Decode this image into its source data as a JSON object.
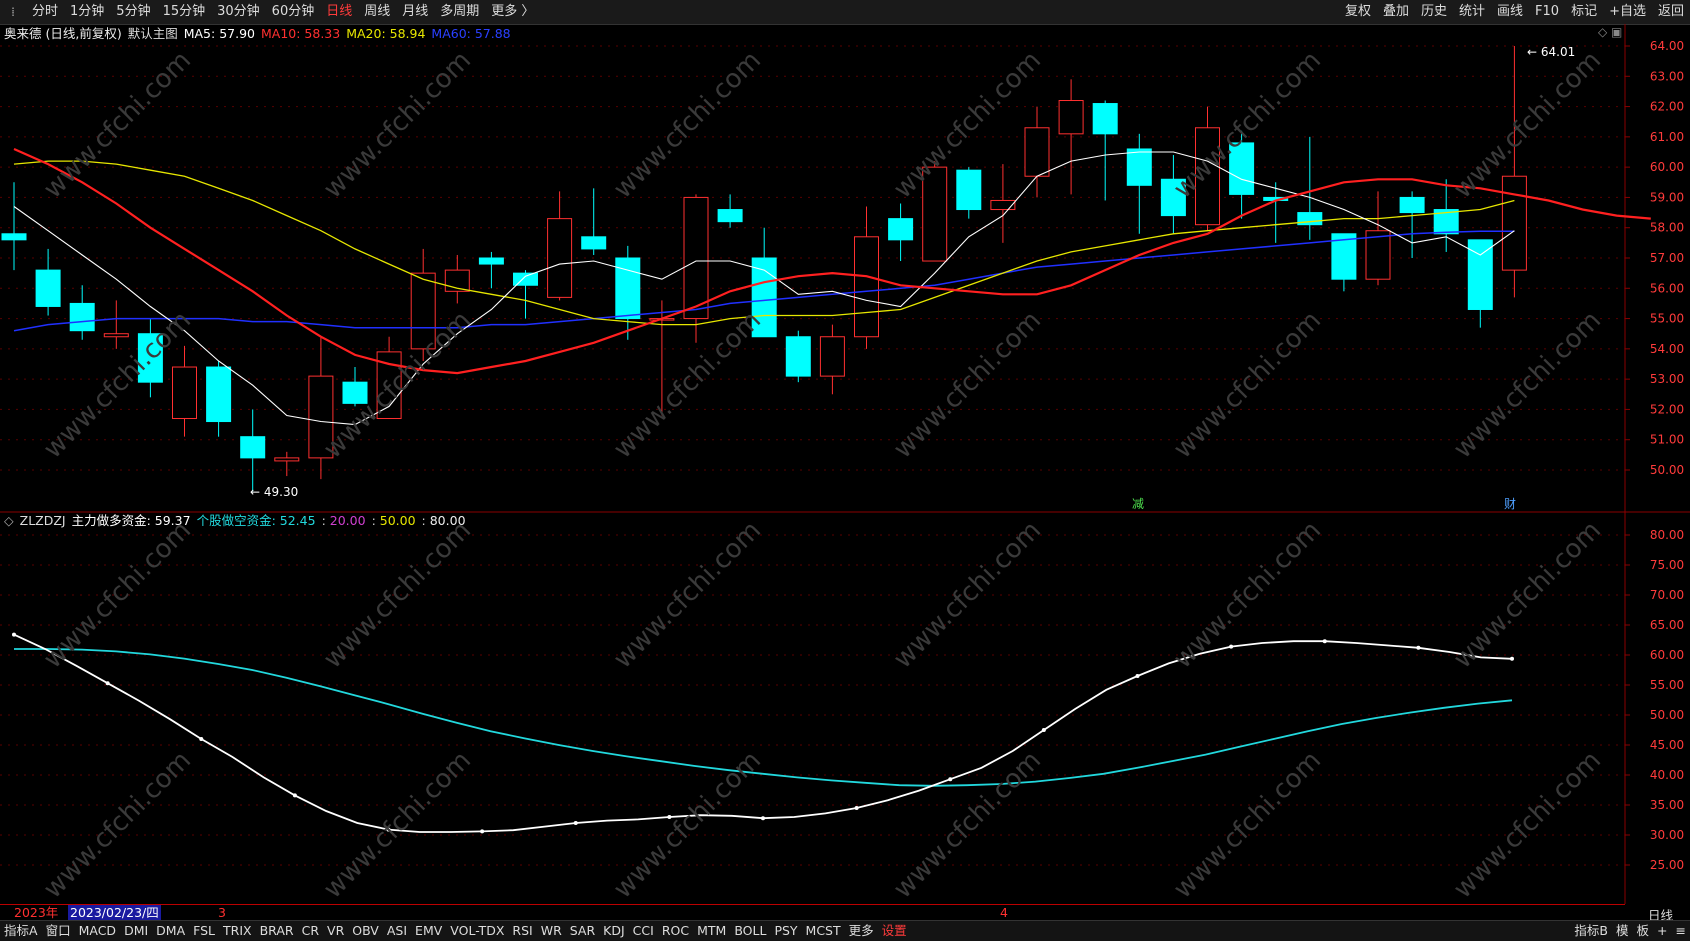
{
  "topbar": {
    "menu_glyph": "⁞",
    "periods": [
      "分时",
      "1分钟",
      "5分钟",
      "15分钟",
      "30分钟",
      "60分钟",
      "日线",
      "周线",
      "月线",
      "多周期",
      "更多 〉"
    ],
    "active_period": "日线",
    "right_buttons": [
      "复权",
      "叠加",
      "历史",
      "统计",
      "画线",
      "F10",
      "标记",
      "+自选",
      "返回"
    ]
  },
  "main_panel": {
    "title": "奥来德 (日线,前复权)",
    "indicator_name": "默认主图",
    "ma5": "MA5: 57.90",
    "ma10": "MA10: 58.33",
    "ma20": "MA20: 58.94",
    "ma60": "MA60: 57.88",
    "high_label": "64.01",
    "low_label": "49.30",
    "markers": [
      {
        "text": "减"
      },
      {
        "text": "财"
      }
    ],
    "colors": {
      "ma5": "#ffffff",
      "ma10": "#ff2020",
      "ma20": "#e6e600",
      "ma60": "#2030ff",
      "up": "#ff3030",
      "down": "#00ffff"
    }
  },
  "chart_data": [
    {
      "type": "candlestick",
      "title": "奥来德 (日线,前复权)",
      "ylim": [
        49.3,
        64.5
      ],
      "y_ticks": [
        "64.00",
        "63.00",
        "62.00",
        "61.00",
        "60.00",
        "59.00",
        "58.00",
        "57.00",
        "56.00",
        "55.00",
        "54.00",
        "53.00",
        "52.00",
        "51.00",
        "50.00"
      ],
      "candles": [
        {
          "o": 57.8,
          "h": 59.5,
          "l": 56.6,
          "c": 57.6
        },
        {
          "o": 56.6,
          "h": 57.3,
          "l": 55.1,
          "c": 55.4
        },
        {
          "o": 55.5,
          "h": 56.1,
          "l": 54.3,
          "c": 54.6
        },
        {
          "o": 54.4,
          "h": 55.6,
          "l": 54.0,
          "c": 54.5
        },
        {
          "o": 54.5,
          "h": 55.0,
          "l": 52.4,
          "c": 52.9
        },
        {
          "o": 51.7,
          "h": 54.1,
          "l": 51.1,
          "c": 53.4
        },
        {
          "o": 53.4,
          "h": 53.6,
          "l": 51.1,
          "c": 51.6
        },
        {
          "o": 51.1,
          "h": 52.0,
          "l": 49.3,
          "c": 50.4
        },
        {
          "o": 50.3,
          "h": 50.6,
          "l": 49.8,
          "c": 50.4
        },
        {
          "o": 50.4,
          "h": 54.4,
          "l": 49.7,
          "c": 53.1
        },
        {
          "o": 52.9,
          "h": 53.4,
          "l": 52.1,
          "c": 52.2
        },
        {
          "o": 51.7,
          "h": 54.4,
          "l": 51.7,
          "c": 53.9
        },
        {
          "o": 54.0,
          "h": 57.3,
          "l": 53.6,
          "c": 56.5
        },
        {
          "o": 55.9,
          "h": 57.1,
          "l": 55.5,
          "c": 56.6
        },
        {
          "o": 57.0,
          "h": 57.2,
          "l": 56.0,
          "c": 56.8
        },
        {
          "o": 56.5,
          "h": 56.6,
          "l": 55.0,
          "c": 56.1
        },
        {
          "o": 55.7,
          "h": 59.2,
          "l": 55.6,
          "c": 58.3
        },
        {
          "o": 57.7,
          "h": 59.3,
          "l": 57.1,
          "c": 57.3
        },
        {
          "o": 57.0,
          "h": 57.4,
          "l": 54.3,
          "c": 55.0
        },
        {
          "o": 55.0,
          "h": 55.6,
          "l": 51.8,
          "c": 55.0
        },
        {
          "o": 55.0,
          "h": 59.1,
          "l": 54.2,
          "c": 59.0
        },
        {
          "o": 58.6,
          "h": 59.1,
          "l": 58.0,
          "c": 58.2
        },
        {
          "o": 57.0,
          "h": 58.0,
          "l": 55.5,
          "c": 54.4
        },
        {
          "o": 54.4,
          "h": 54.6,
          "l": 52.9,
          "c": 53.1
        },
        {
          "o": 53.1,
          "h": 54.8,
          "l": 52.5,
          "c": 54.4
        },
        {
          "o": 54.4,
          "h": 58.7,
          "l": 54.0,
          "c": 57.7
        },
        {
          "o": 58.3,
          "h": 58.8,
          "l": 56.9,
          "c": 57.6
        },
        {
          "o": 56.9,
          "h": 60.2,
          "l": 56.9,
          "c": 60.0
        },
        {
          "o": 59.9,
          "h": 60.0,
          "l": 58.3,
          "c": 58.6
        },
        {
          "o": 58.6,
          "h": 60.1,
          "l": 57.5,
          "c": 58.9
        },
        {
          "o": 59.7,
          "h": 62.0,
          "l": 59.0,
          "c": 61.3
        },
        {
          "o": 61.1,
          "h": 62.9,
          "l": 59.1,
          "c": 62.2
        },
        {
          "o": 62.1,
          "h": 62.2,
          "l": 58.9,
          "c": 61.1
        },
        {
          "o": 60.6,
          "h": 61.1,
          "l": 57.8,
          "c": 59.4
        },
        {
          "o": 59.6,
          "h": 60.4,
          "l": 57.8,
          "c": 58.4
        },
        {
          "o": 58.1,
          "h": 62.0,
          "l": 57.9,
          "c": 61.3
        },
        {
          "o": 60.8,
          "h": 61.2,
          "l": 58.3,
          "c": 59.1
        },
        {
          "o": 59.0,
          "h": 59.5,
          "l": 57.5,
          "c": 58.9
        },
        {
          "o": 58.5,
          "h": 61.0,
          "l": 57.6,
          "c": 58.1
        },
        {
          "o": 57.8,
          "h": 57.8,
          "l": 55.9,
          "c": 56.3
        },
        {
          "o": 56.3,
          "h": 59.2,
          "l": 56.1,
          "c": 57.9
        },
        {
          "o": 59.0,
          "h": 59.2,
          "l": 57.0,
          "c": 58.5
        },
        {
          "o": 58.6,
          "h": 59.6,
          "l": 57.2,
          "c": 57.8
        },
        {
          "o": 57.6,
          "h": 57.6,
          "l": 54.7,
          "c": 55.3
        },
        {
          "o": 56.6,
          "h": 64.0,
          "l": 55.7,
          "c": 59.7
        }
      ],
      "ma5": [
        58.7,
        57.9,
        57.1,
        56.3,
        55.4,
        54.6,
        53.6,
        52.8,
        51.8,
        51.6,
        51.5,
        52.1,
        53.5,
        54.5,
        55.3,
        56.4,
        56.8,
        56.9,
        56.6,
        56.3,
        56.9,
        56.9,
        56.6,
        55.8,
        55.9,
        55.6,
        55.4,
        56.5,
        57.7,
        58.4,
        59.7,
        60.2,
        60.4,
        60.5,
        60.5,
        60.2,
        59.6,
        59.3,
        59.0,
        58.6,
        58.1,
        57.5,
        57.7,
        57.1,
        57.9
      ],
      "ma10": [
        60.6,
        60.1,
        59.5,
        58.8,
        58.0,
        57.3,
        56.6,
        55.9,
        55.1,
        54.4,
        53.8,
        53.5,
        53.3,
        53.2,
        53.4,
        53.6,
        53.9,
        54.2,
        54.6,
        55.0,
        55.4,
        55.9,
        56.2,
        56.4,
        56.5,
        56.4,
        56.1,
        56.0,
        55.9,
        55.8,
        55.8,
        56.1,
        56.6,
        57.1,
        57.5,
        57.8,
        58.4,
        58.9,
        59.2,
        59.5,
        59.6,
        59.6,
        59.4,
        59.3,
        59.1,
        58.9,
        58.6,
        58.4,
        58.3
      ],
      "ma20": [
        60.1,
        60.2,
        60.2,
        60.1,
        59.9,
        59.7,
        59.3,
        58.9,
        58.4,
        57.9,
        57.3,
        56.8,
        56.3,
        56.0,
        55.8,
        55.6,
        55.3,
        55.0,
        54.9,
        54.8,
        54.8,
        55.0,
        55.1,
        55.1,
        55.1,
        55.2,
        55.3,
        55.7,
        56.1,
        56.5,
        56.9,
        57.2,
        57.4,
        57.6,
        57.8,
        57.9,
        58.0,
        58.1,
        58.2,
        58.3,
        58.3,
        58.4,
        58.5,
        58.6,
        58.9
      ],
      "ma60": [
        54.6,
        54.8,
        54.9,
        55.0,
        55.0,
        55.0,
        55.0,
        54.9,
        54.9,
        54.8,
        54.7,
        54.7,
        54.7,
        54.7,
        54.8,
        54.8,
        54.9,
        55.0,
        55.1,
        55.2,
        55.3,
        55.5,
        55.6,
        55.7,
        55.8,
        55.9,
        56.0,
        56.1,
        56.3,
        56.5,
        56.7,
        56.8,
        56.9,
        57.0,
        57.1,
        57.2,
        57.3,
        57.4,
        57.5,
        57.6,
        57.7,
        57.8,
        57.85,
        57.88,
        57.88
      ]
    },
    {
      "type": "line",
      "title": "ZLZDZJ",
      "ylim": [
        20,
        80
      ],
      "y_ticks": [
        "80.00",
        "75.00",
        "70.00",
        "65.00",
        "60.00",
        "55.00",
        "50.00",
        "45.00",
        "40.00",
        "35.00",
        "30.00",
        "25.00"
      ],
      "series": [
        {
          "name": "主力做多资金",
          "color": "#ffffff",
          "values": [
            63.4,
            61.0,
            58.2,
            55.3,
            52.4,
            49.3,
            46.0,
            43.0,
            39.6,
            36.6,
            34.0,
            32.0,
            30.9,
            30.5,
            30.5,
            30.6,
            30.8,
            31.4,
            32.0,
            32.4,
            32.6,
            33.0,
            33.3,
            33.2,
            32.8,
            33.0,
            33.6,
            34.5,
            35.8,
            37.4,
            39.3,
            41.2,
            44.0,
            47.5,
            51.0,
            54.2,
            56.5,
            58.6,
            60.2,
            61.4,
            62.0,
            62.3,
            62.3,
            62.0,
            61.6,
            61.2,
            60.5,
            59.6,
            59.37
          ]
        },
        {
          "name": "个股做空资金",
          "color": "#22d8dd",
          "values": [
            61.0,
            61.0,
            60.9,
            60.6,
            60.1,
            59.4,
            58.5,
            57.5,
            56.2,
            54.8,
            53.3,
            51.8,
            50.2,
            48.7,
            47.3,
            46.1,
            45.0,
            44.0,
            43.1,
            42.3,
            41.5,
            40.8,
            40.2,
            39.6,
            39.1,
            38.7,
            38.3,
            38.2,
            38.3,
            38.5,
            38.9,
            39.5,
            40.2,
            41.2,
            42.3,
            43.4,
            44.7,
            46.0,
            47.3,
            48.5,
            49.5,
            50.4,
            51.2,
            51.9,
            52.45
          ]
        }
      ],
      "legend_values": {
        "long": "主力做多资金: 59.37",
        "short_label": "个股做空资金:",
        "short_value": "52.45",
        "lvl20": "20.00",
        "lvl50": "50.00",
        "lvl80": "80.00"
      }
    }
  ],
  "datebar": {
    "year": "2023年",
    "date": "2023/02/23/四",
    "month3": "3",
    "month4": "4"
  },
  "right_label_bottom": "日线",
  "bottombar": {
    "items": [
      "指标A",
      "窗口",
      "MACD",
      "DMI",
      "DMA",
      "FSL",
      "TRIX",
      "BRAR",
      "CR",
      "VR",
      "OBV",
      "ASI",
      "EMV",
      "VOL-TDX",
      "RSI",
      "WR",
      "SAR",
      "KDJ",
      "CCI",
      "ROC",
      "MTM",
      "BOLL",
      "PSY",
      "MCST",
      "更多",
      "设置"
    ],
    "right_items": [
      "指标B",
      "模",
      "板",
      "+",
      "≡"
    ]
  },
  "watermark_text": "www.cfchi.com"
}
